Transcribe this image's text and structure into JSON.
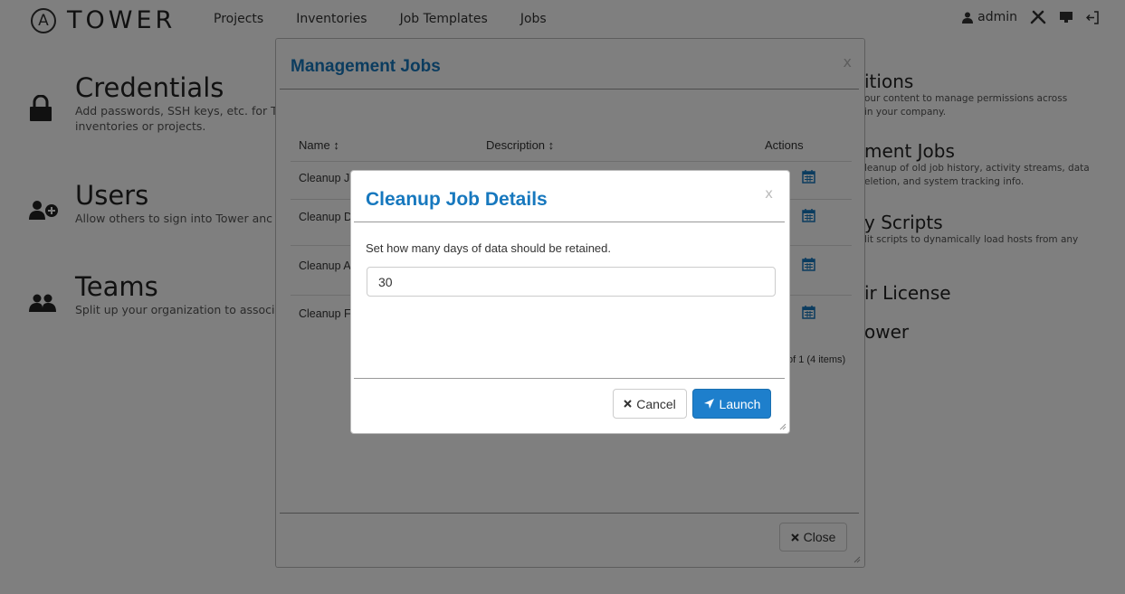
{
  "brand": {
    "logo_letter": "A",
    "name": "TOWER"
  },
  "nav": {
    "links": [
      "Projects",
      "Inventories",
      "Job Templates",
      "Jobs"
    ],
    "user": "admin"
  },
  "settings_left": [
    {
      "title": "Credentials",
      "desc_line1": "Add passwords, SSH keys, etc. for T",
      "desc_line2": "inventories or projects."
    },
    {
      "title": "Users",
      "desc_line1": "Allow others to sign into Tower anc"
    },
    {
      "title": "Teams",
      "desc_line1": "Split up your organization to associ"
    }
  ],
  "settings_right": [
    {
      "title": "itions",
      "desc_line1": "our content to manage permissions across",
      "desc_line2": "in your company."
    },
    {
      "title": "ment Jobs",
      "desc_line1": "leanup of old job history, activity streams, data",
      "desc_line2": "eletion, and system tracking info."
    },
    {
      "title": "y Scripts",
      "desc_line1": "lit scripts to dynamically load hosts from any"
    },
    {
      "title": "ir License"
    },
    {
      "title": "ower"
    }
  ],
  "mgmt_modal": {
    "title": "Management Jobs",
    "close_x": "x",
    "columns": {
      "name": "Name",
      "description": "Description",
      "actions": "Actions"
    },
    "sort_icon": "↕",
    "rows": [
      "Cleanup J",
      "Cleanup D",
      "Cleanup A",
      "Cleanup F"
    ],
    "pagination": "of 1 (4 items)",
    "close_label": "Close"
  },
  "cleanup_modal": {
    "title": "Cleanup Job Details",
    "close_x": "x",
    "prompt": "Set how many days of data should be retained.",
    "days_value": "30",
    "cancel_label": "Cancel",
    "launch_label": "Launch"
  },
  "colors": {
    "accent": "#1778be",
    "primary_button": "#1e7fcc"
  }
}
